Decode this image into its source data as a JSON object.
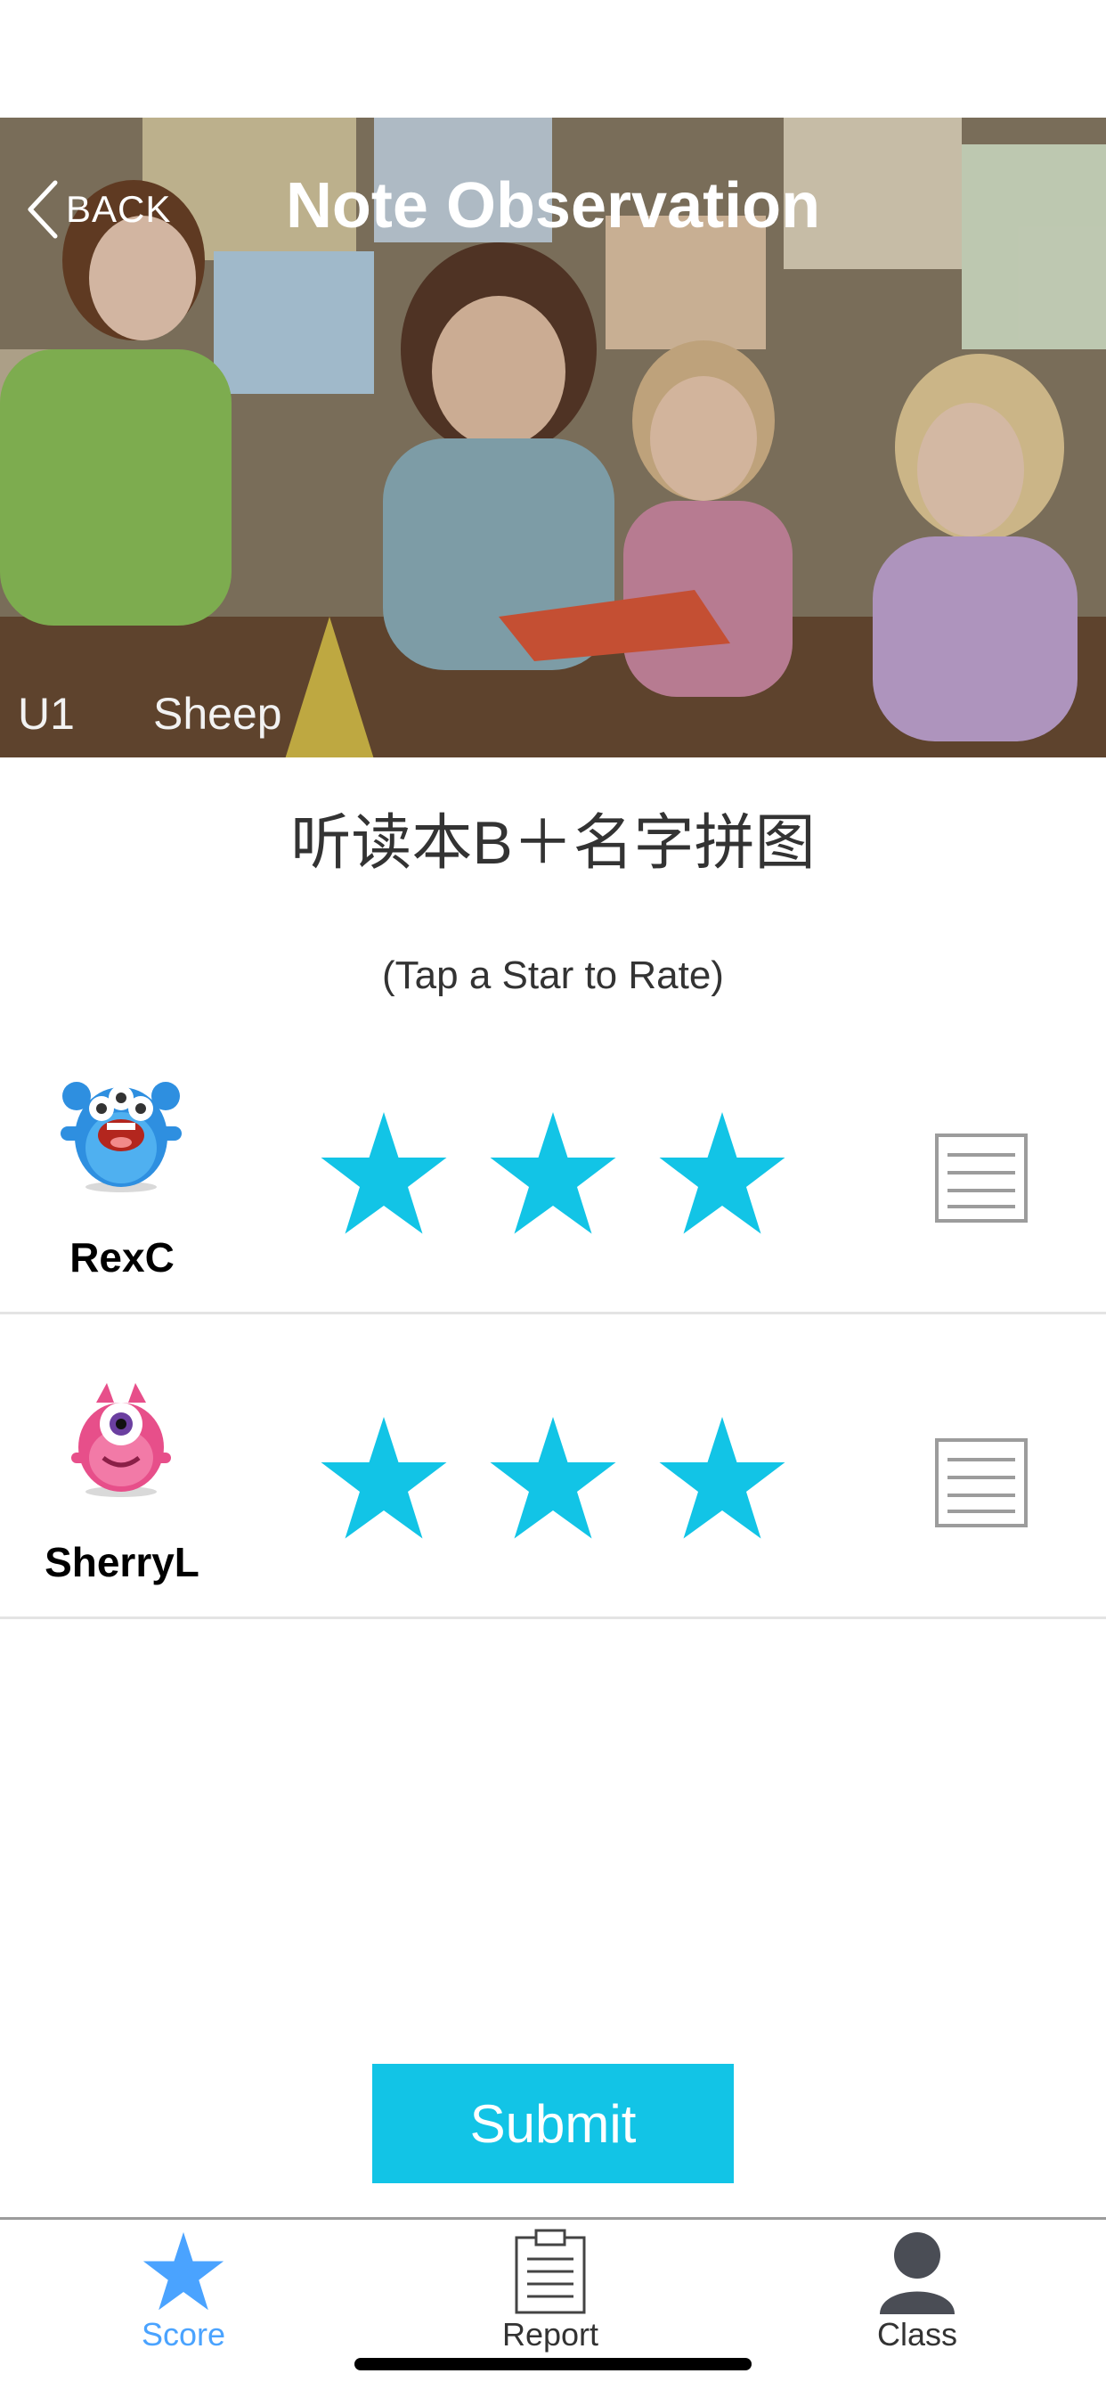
{
  "header": {
    "back_label": "BACK",
    "title": "Note Observation"
  },
  "hero": {
    "unit": "U1",
    "lesson": "Sheep"
  },
  "activity": {
    "title": "听读本B＋名字拼图",
    "hint": "(Tap a Star to Rate)"
  },
  "students": [
    {
      "name": "RexC",
      "avatar": "blue-monster-avatar",
      "stars": 3
    },
    {
      "name": "SherryL",
      "avatar": "pink-monster-avatar",
      "stars": 3
    }
  ],
  "submit_label": "Submit",
  "tabs": [
    {
      "label": "Score",
      "icon": "star-icon",
      "active": true
    },
    {
      "label": "Report",
      "icon": "clipboard-icon",
      "active": false
    },
    {
      "label": "Class",
      "icon": "person-icon",
      "active": false
    }
  ],
  "colors": {
    "accent": "#12c4e6",
    "star": "#12c4e6",
    "tab_active": "#4aa3ff"
  }
}
